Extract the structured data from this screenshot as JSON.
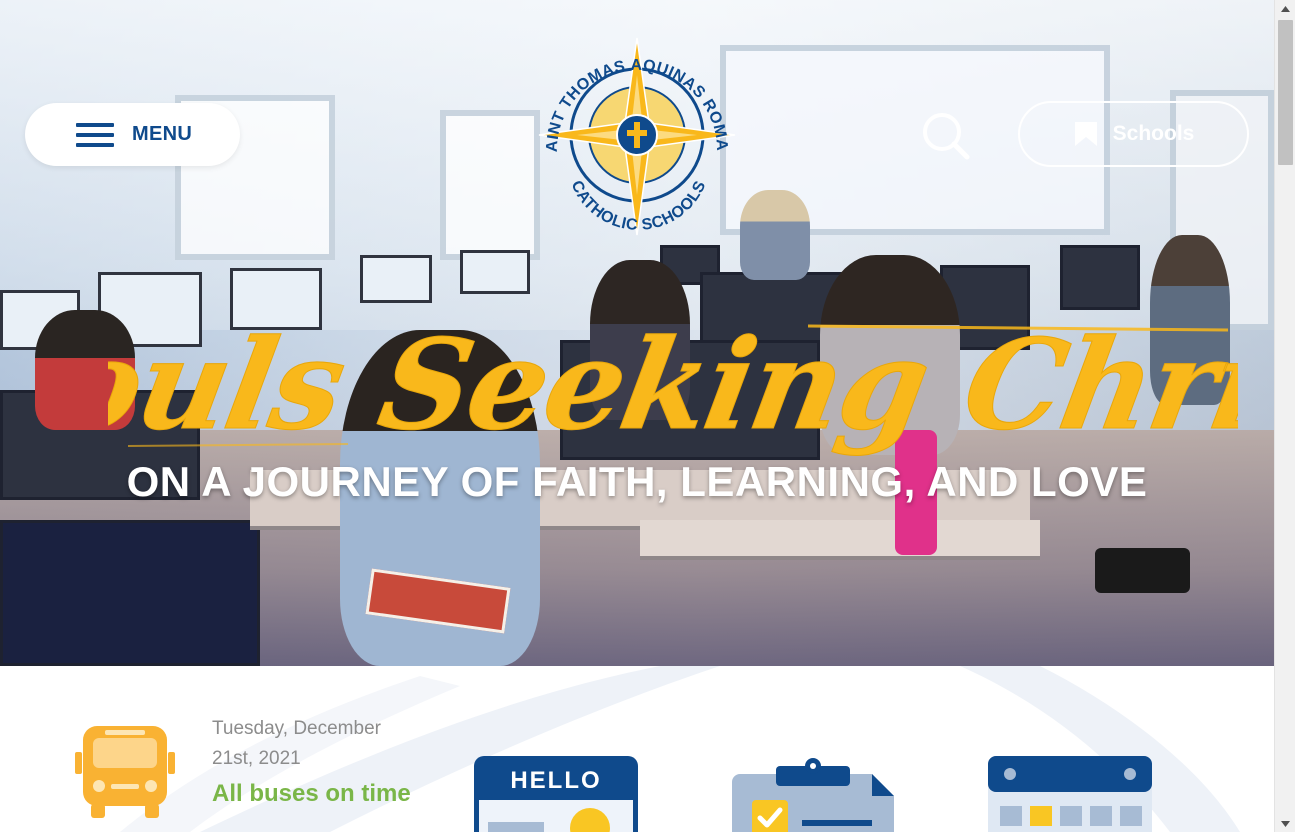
{
  "header": {
    "menu_label": "MENU",
    "schools_label": "Schools",
    "logo_text_top": "SAINT THOMAS AQUINAS ROMAN",
    "logo_text_bottom": "CATHOLIC SCHOOLS"
  },
  "hero": {
    "headline": "Souls Seeking Christ",
    "subheadline": "ON A JOURNEY OF FAITH, LEARNING, AND LOVE"
  },
  "bus_status": {
    "date": "Tuesday, December 21st, 2021",
    "status": "All buses on time"
  },
  "quick_links": {
    "hello_label": "HELLO"
  },
  "colors": {
    "navy": "#0f4a8c",
    "gold": "#f9b81b",
    "green": "#7ab648",
    "bus_orange": "#f9b233"
  },
  "icons": [
    "hamburger-icon",
    "search-icon",
    "bookmark-icon",
    "school-bus-icon",
    "name-tag-icon",
    "clipboard-checklist-icon",
    "calendar-icon"
  ]
}
